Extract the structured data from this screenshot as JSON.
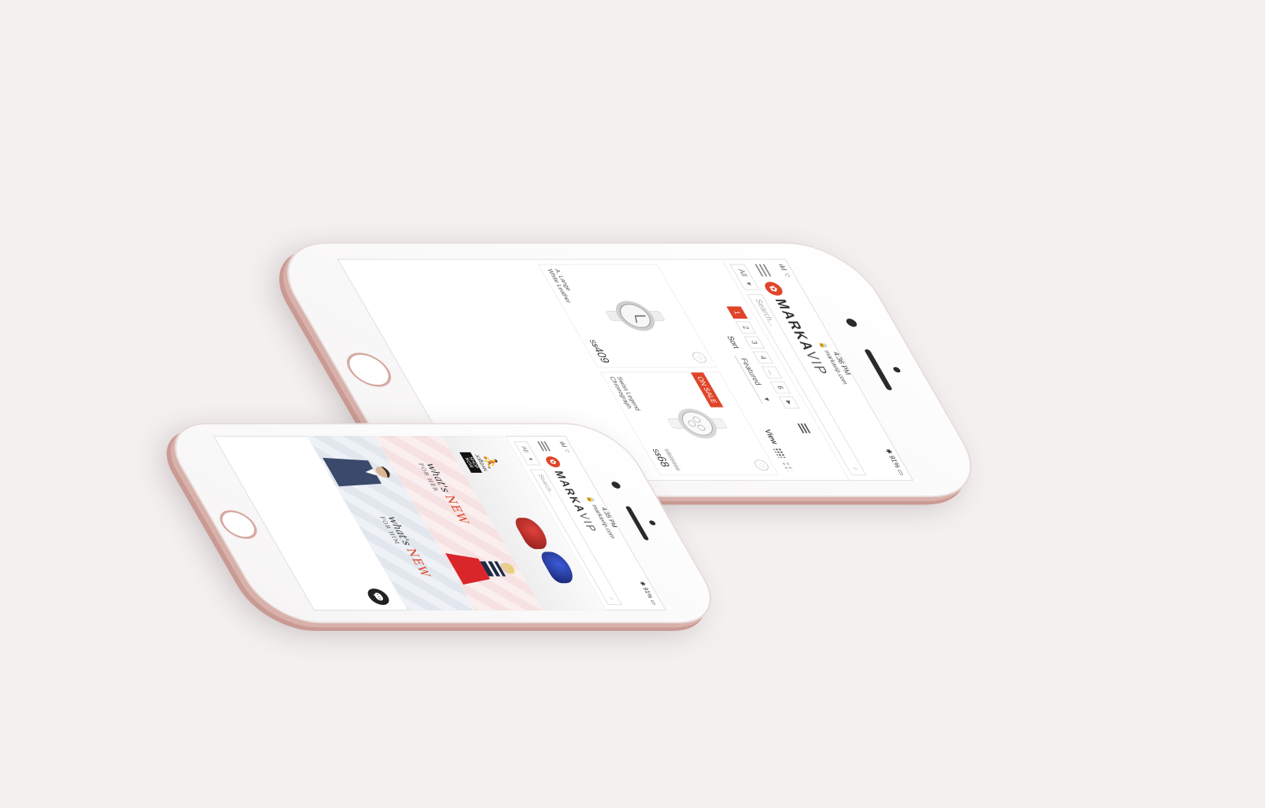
{
  "colors": {
    "accent": "#e0452a",
    "phone_frame": "#d6aaa2",
    "background": "#f3f0f0"
  },
  "large_phone": {
    "status": {
      "carrier": "ılıl ⌔",
      "time": "4:36 PM",
      "url": "🔒 markavip.com",
      "battery": "✱ 91% ▭"
    },
    "logo": {
      "bold": "MARKA",
      "light": "VIP"
    },
    "search": {
      "category": "All",
      "placeholder": "Search...",
      "icon": "search-icon"
    },
    "pagination": {
      "pages": [
        "1",
        "2",
        "3",
        "4",
        "...",
        "6"
      ],
      "active": "1",
      "next": "►"
    },
    "sort": {
      "label": "Sort",
      "value": "Featured"
    },
    "view": {
      "label": "View"
    },
    "products": [
      {
        "badge": "",
        "name": "A. Lange White Leather",
        "currency": "S$",
        "price": "409",
        "old_price": ""
      },
      {
        "badge": "ON SALE",
        "name": "Swiss Legend Chronograph",
        "currency": "S$",
        "price": "68",
        "old_price": "S$99999"
      }
    ]
  },
  "small_phone": {
    "status": {
      "carrier": "ılıl ⌔",
      "time": "4:35 PM",
      "url": "🔒 markavip.com",
      "battery": "✱ 91% ▭"
    },
    "logo": {
      "bold": "MARKA",
      "light": "VIP"
    },
    "search": {
      "category": "All",
      "placeholder": "Search..."
    },
    "banners": {
      "jordan": {
        "brand": "JORDAN",
        "tag": "SHOP NOW"
      },
      "women": {
        "what": "what's",
        "new": "NEW",
        "for": "FOR HER"
      },
      "men": {
        "what": "what's",
        "new": "NEW",
        "for": "FOR HIM"
      }
    }
  }
}
